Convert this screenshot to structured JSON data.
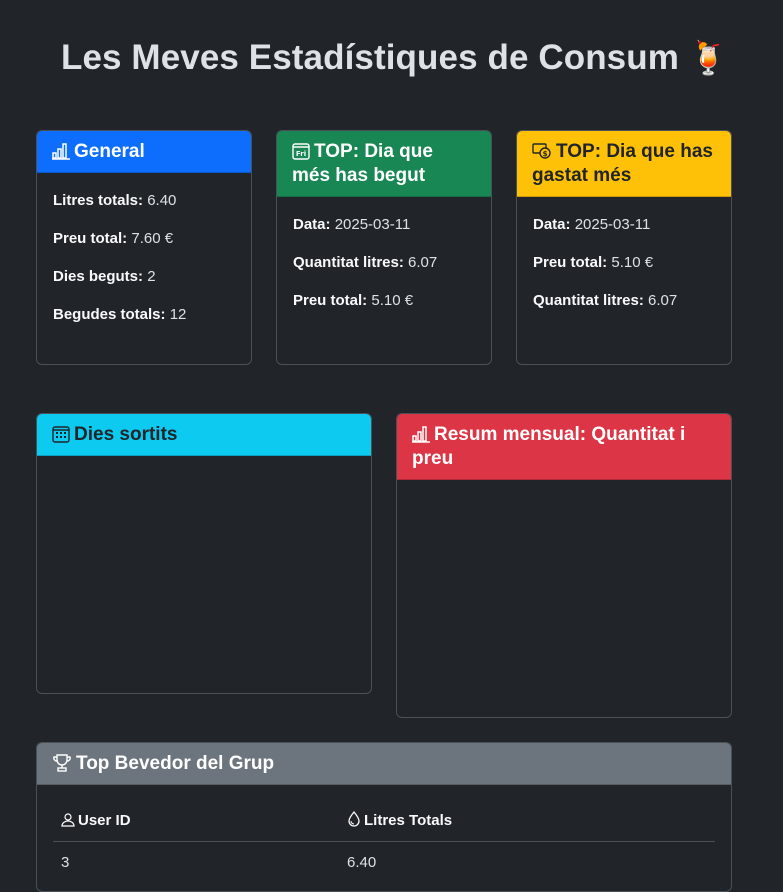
{
  "page": {
    "title": "Les Meves Estadístiques de Consum",
    "title_emoji": "🍹"
  },
  "general": {
    "title": "General",
    "icon": "bar-chart-icon",
    "rows": [
      {
        "label": "Litres totals:",
        "value": "6.40"
      },
      {
        "label": "Preu total:",
        "value": "7.60 €"
      },
      {
        "label": "Dies beguts:",
        "value": "2"
      },
      {
        "label": "Begudes totals:",
        "value": "12"
      }
    ]
  },
  "top_drink_day": {
    "title": "TOP: Dia que més has begut",
    "icon": "calendar-fri-icon",
    "rows": [
      {
        "label": "Data:",
        "value": "2025-03-11"
      },
      {
        "label": "Quantitat litres:",
        "value": "6.07"
      },
      {
        "label": "Preu total:",
        "value": "5.10 €"
      }
    ]
  },
  "top_spend_day": {
    "title": "TOP: Dia que has gastat més",
    "icon": "cash-coin-icon",
    "rows": [
      {
        "label": "Data:",
        "value": "2025-03-11"
      },
      {
        "label": "Preu total:",
        "value": "5.10 €"
      },
      {
        "label": "Quantitat litres:",
        "value": "6.07"
      }
    ]
  },
  "days_out": {
    "title": "Dies sortits",
    "icon": "calendar-grid-icon"
  },
  "monthly": {
    "title": "Resum mensual: Quantitat i preu",
    "icon": "bar-chart-icon"
  },
  "top_drinker": {
    "title": "Top Bevedor del Grup",
    "icon": "trophy-icon",
    "columns": [
      "User ID",
      "Litres Totals"
    ],
    "rows": [
      {
        "user_id": "3",
        "litres": "6.40"
      }
    ]
  },
  "colors": {
    "background": "#212529",
    "primary": "#0d6efd",
    "success": "#198754",
    "warning": "#ffc107",
    "info": "#0dcaf0",
    "danger": "#dc3545",
    "secondary": "#6c757d"
  }
}
